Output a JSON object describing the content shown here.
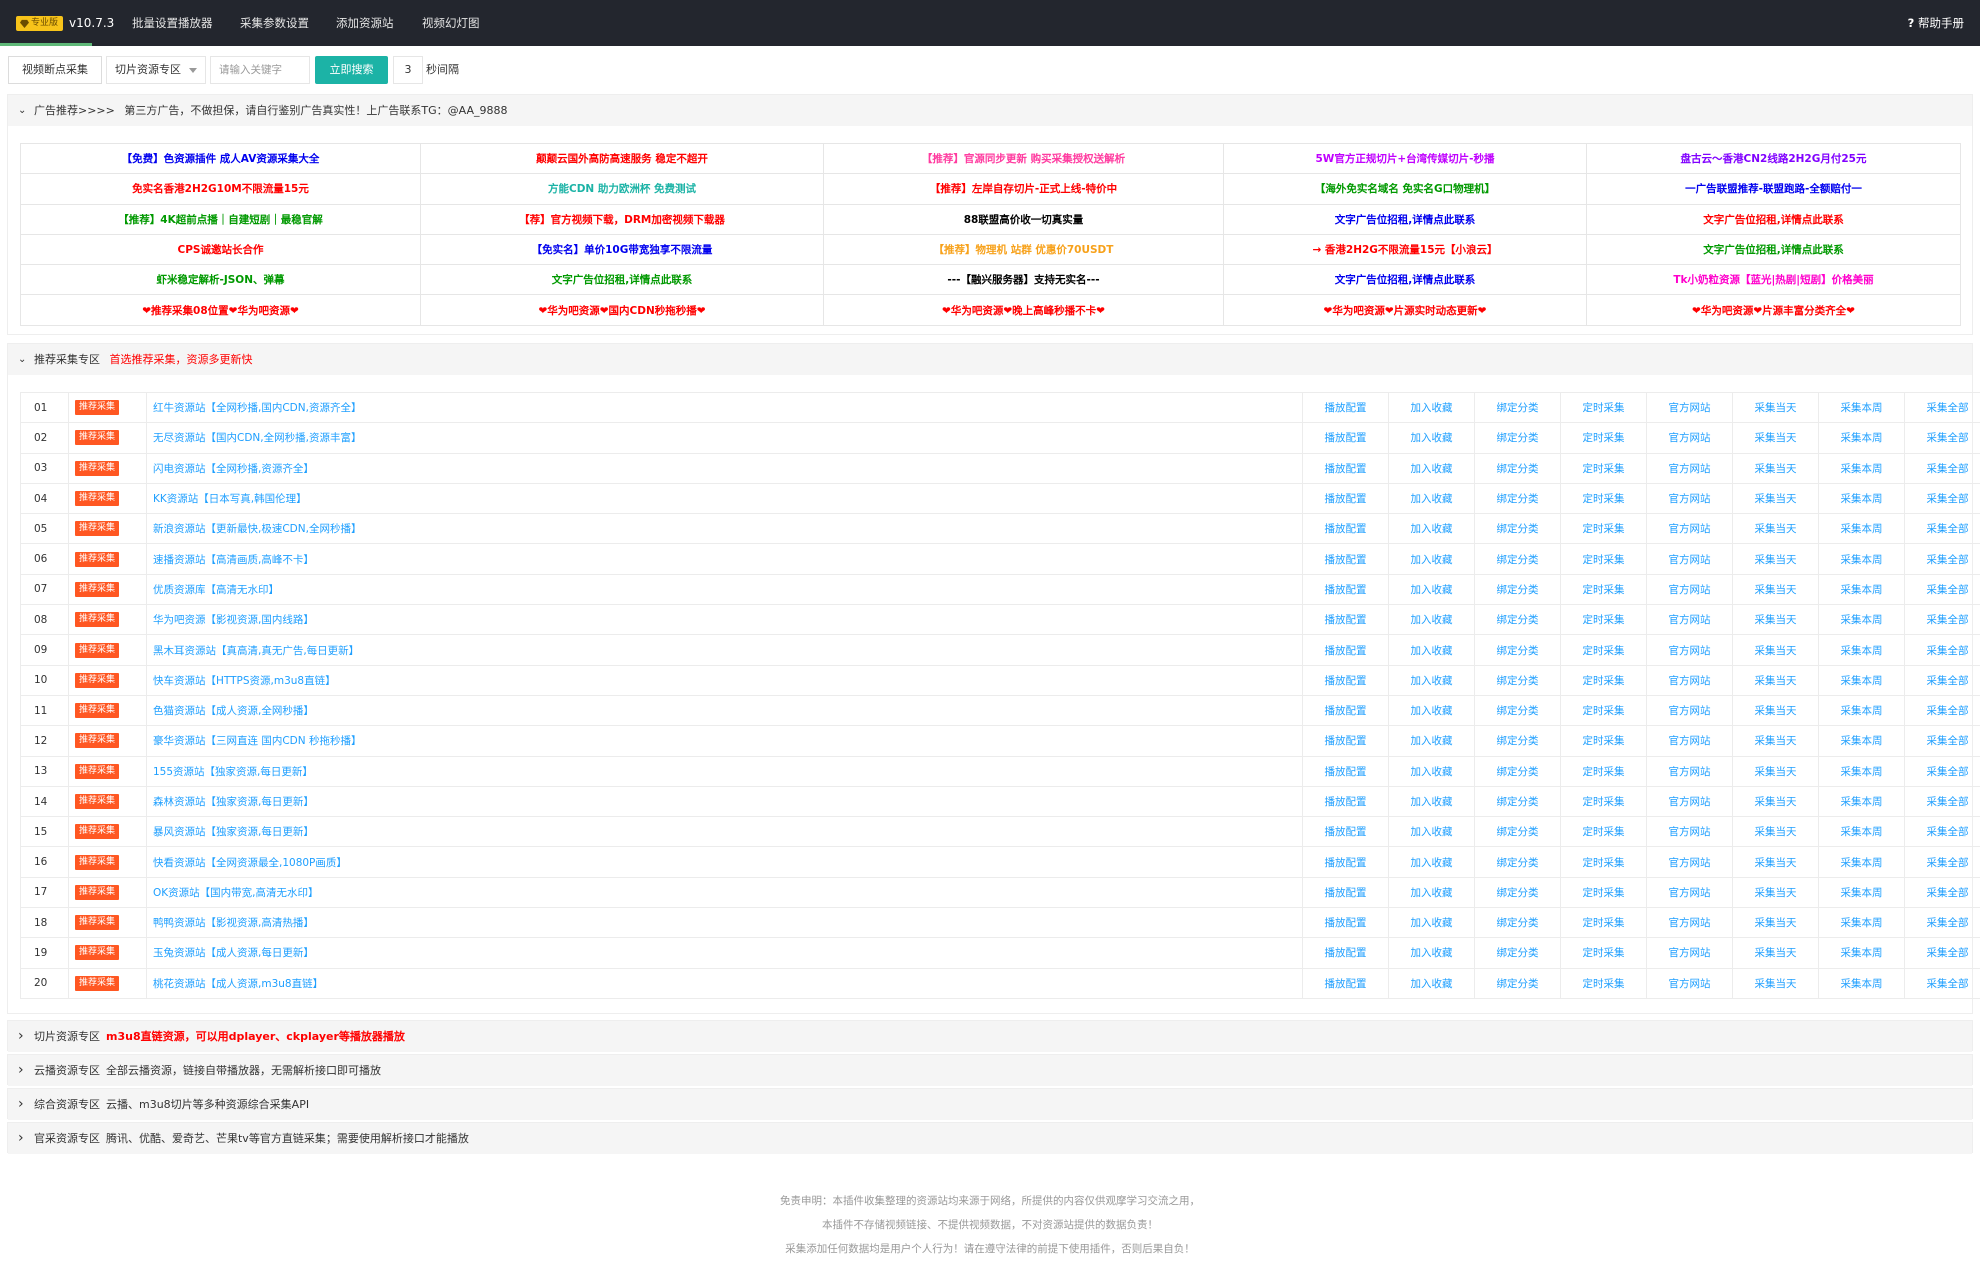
{
  "nav": {
    "badge": "专业版",
    "version": "v10.7.3",
    "items": [
      "批量设置播放器",
      "采集参数设置",
      "添加资源站",
      "视频幻灯图"
    ],
    "help": "帮助手册"
  },
  "toolbar": {
    "resume_button": "视频断点采集",
    "select_value": "切片资源专区",
    "search_placeholder": "请输入关键字",
    "search_button": "立即搜索",
    "interval_value": "3",
    "interval_label": "秒间隔"
  },
  "ad_panel": {
    "title": "广告推荐>>>>",
    "note": "第三方广告，不做担保，请自行鉴别广告真实性！上广告联系TG：@AA_9888",
    "rows": [
      [
        {
          "text": "【免费】色资源插件 成人AV资源采集大全",
          "color": "#0000ee"
        },
        {
          "text": "颠颠云国外高防高速服务 稳定不超开",
          "color": "#ff0000"
        },
        {
          "text": "【推荐】官源同步更新 购买采集授权送解析",
          "color": "#ff3ca0"
        },
        {
          "text": "5W官方正规切片+台湾传媒切片-秒播",
          "color": "#c000ff"
        },
        {
          "text": "盘古云～香港CN2线路2H2G月付25元",
          "color": "#8000ff"
        }
      ],
      [
        {
          "text": "免实名香港2H2G10M不限流量15元",
          "color": "#ff0000"
        },
        {
          "text": "方能CDN 助力欧洲杯 免费测试",
          "color": "#1cb3a6"
        },
        {
          "text": "【推荐】左岸自存切片-正式上线-特价中",
          "color": "#ff0000"
        },
        {
          "text": "【海外免实名域名 免实名G口物理机】",
          "color": "#009900"
        },
        {
          "text": "一广告联盟推荐-联盟跑路-全额赔付一",
          "color": "#0000ee"
        }
      ],
      [
        {
          "text": "【推荐】4K超前点播｜自建短剧｜最稳官解",
          "color": "#009900"
        },
        {
          "text": "【荐】官方视频下载，DRM加密视频下载器",
          "color": "#ff0000"
        },
        {
          "text": "88联盟高价收一切真实量",
          "color": "#000000"
        },
        {
          "text": "文字广告位招租,详情点此联系",
          "color": "#0000ee"
        },
        {
          "text": "文字广告位招租,详情点此联系",
          "color": "#ff0000"
        }
      ],
      [
        {
          "text": "CPS诚邀站长合作",
          "color": "#ff0000"
        },
        {
          "text": "【免实名】单价10G带宽独享不限流量",
          "color": "#0000ee"
        },
        {
          "text": "【推荐】物理机 站群 优惠价70USDT",
          "color": "#f7a11a"
        },
        {
          "text": "→ 香港2H2G不限流量15元【小浪云】",
          "color": "#ff0000"
        },
        {
          "text": "文字广告位招租,详情点此联系",
          "color": "#009900"
        }
      ],
      [
        {
          "text": "虾米稳定解析-JSON、弹幕",
          "color": "#009900"
        },
        {
          "text": "文字广告位招租,详情点此联系",
          "color": "#009900"
        },
        {
          "text": "---【融兴服务器】支持无实名---",
          "color": "#000000"
        },
        {
          "text": "文字广告位招租,详情点此联系",
          "color": "#0000ee"
        },
        {
          "text": "Tk小奶粒资源【蓝光|热剧|短剧】价格美丽",
          "color": "#ff00cc"
        }
      ],
      [
        {
          "text": "❤推荐采集08位置❤华为吧资源❤",
          "color": "#ff0000"
        },
        {
          "text": "❤华为吧资源❤国内CDN秒拖秒播❤",
          "color": "#ff0000"
        },
        {
          "text": "❤华为吧资源❤晚上高峰秒播不卡❤",
          "color": "#ff0000"
        },
        {
          "text": "❤华为吧资源❤片源实时动态更新❤",
          "color": "#ff0000"
        },
        {
          "text": "❤华为吧资源❤片源丰富分类齐全❤",
          "color": "#ff0000"
        }
      ]
    ]
  },
  "recommend_panel": {
    "title": "推荐采集专区",
    "note": "首选推荐采集，资源多更新快",
    "tag": "推荐采集",
    "actions": [
      "播放配置",
      "加入收藏",
      "绑定分类",
      "定时采集",
      "官方网站",
      "采集当天",
      "采集本周",
      "采集全部"
    ],
    "rows": [
      {
        "num": "01",
        "name": "红牛资源站【全网秒播,国内CDN,资源齐全】"
      },
      {
        "num": "02",
        "name": "无尽资源站【国内CDN,全网秒播,资源丰富】"
      },
      {
        "num": "03",
        "name": "闪电资源站【全网秒播,资源齐全】"
      },
      {
        "num": "04",
        "name": "KK资源站【日本写真,韩国伦理】"
      },
      {
        "num": "05",
        "name": "新浪资源站【更新最快,极速CDN,全网秒播】"
      },
      {
        "num": "06",
        "name": "速播资源站【高清画质,高峰不卡】"
      },
      {
        "num": "07",
        "name": "优质资源库【高清无水印】"
      },
      {
        "num": "08",
        "name": "华为吧资源【影视资源,国内线路】"
      },
      {
        "num": "09",
        "name": "黑木耳资源站【真高清,真无广告,每日更新】"
      },
      {
        "num": "10",
        "name": "快车资源站【HTTPS资源,m3u8直链】"
      },
      {
        "num": "11",
        "name": "色猫资源站【成人资源,全网秒播】"
      },
      {
        "num": "12",
        "name": "豪华资源站【三网直连 国内CDN 秒拖秒播】"
      },
      {
        "num": "13",
        "name": "155资源站【独家资源,每日更新】"
      },
      {
        "num": "14",
        "name": "森林资源站【独家资源,每日更新】"
      },
      {
        "num": "15",
        "name": "暴风资源站【独家资源,每日更新】"
      },
      {
        "num": "16",
        "name": "快看资源站【全网资源最全,1080P画质】"
      },
      {
        "num": "17",
        "name": "OK资源站【国内带宽,高清无水印】"
      },
      {
        "num": "18",
        "name": "鸭鸭资源站【影视资源,高清热播】"
      },
      {
        "num": "19",
        "name": "玉兔资源站【成人资源,每日更新】"
      },
      {
        "num": "20",
        "name": "桃花资源站【成人资源,m3u8直链】"
      }
    ]
  },
  "collapsed_panels": [
    {
      "title": "切片资源专区",
      "note": "m3u8直链资源，可以用dplayer、ckplayer等播放器播放",
      "style": "red"
    },
    {
      "title": "云播资源专区",
      "note": "全部云播资源，链接自带播放器，无需解析接口即可播放",
      "style": "dark"
    },
    {
      "title": "综合资源专区",
      "note": "云播、m3u8切片等多种资源综合采集API",
      "style": "dark"
    },
    {
      "title": "官采资源专区",
      "note": "腾讯、优酷、爱奇艺、芒果tv等官方直链采集；需要使用解析接口才能播放",
      "style": "dark"
    }
  ],
  "footer": {
    "line1": "免责申明：本插件收集整理的资源站均来源于网络，所提供的内容仅供观摩学习交流之用，",
    "line2": "本插件不存储视频链接、不提供视频数据，不对资源站提供的数据负责！",
    "line3": "采集添加任何数据均是用户个人行为！请在遵守法律的前提下使用插件，否则后果自负！"
  }
}
